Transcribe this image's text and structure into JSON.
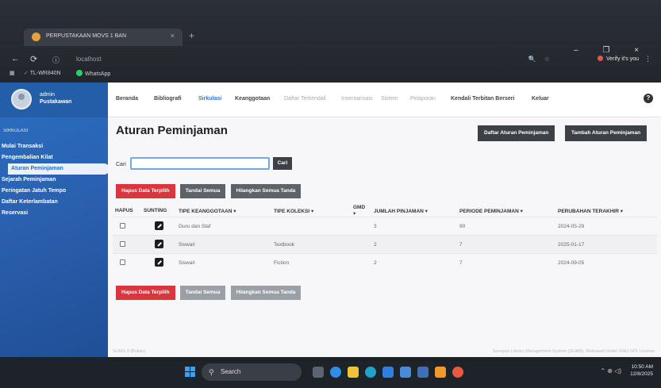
{
  "browser": {
    "tab_title": "PERPUSTAKAAN MOVS 1 BAN",
    "tab_close": "×",
    "new_tab": "+",
    "url": "localhost",
    "window_controls": "– ❐ ×",
    "verify_label": "Verify it's you",
    "bookmarks": [
      "TL-WR840N",
      "WhatsApp"
    ]
  },
  "sidebar": {
    "user_name": "admin",
    "user_role": "Pustakawan",
    "section": "SIRKULASI",
    "items": [
      {
        "label": "Mulai Transaksi"
      },
      {
        "label": "Pengembalian Kilat"
      },
      {
        "label": "Aturan Peminjaman",
        "active": true
      },
      {
        "label": "Sejarah Peminjaman"
      },
      {
        "label": "Peringatan Jatuh Tempo"
      },
      {
        "label": "Daftar Keterlambatan"
      },
      {
        "label": "Reservasi"
      }
    ]
  },
  "topnav": {
    "items": [
      "Beranda",
      "Bibliografi",
      "Sirkulasi",
      "Keanggotaan",
      "Daftar Terkendali",
      "Inventarisasi",
      "Sistem",
      "Pelaporan",
      "Kendali Terbitan Berseri",
      "Keluar"
    ],
    "help": "?"
  },
  "page": {
    "title": "Aturan Peminjaman",
    "btn_list": "Daftar Aturan Peminjaman",
    "btn_add": "Tambah Aturan Peminjaman",
    "search_label": "Cari",
    "search_value": "",
    "search_button": "Cari",
    "btn_delete": "Hapus Data Terpilih",
    "btn_mark_all": "Tandai Semua",
    "btn_unmark_all": "Hilangkan Semua Tanda"
  },
  "table": {
    "headers": [
      "HAPUS",
      "SUNTING",
      "TIPE KEANGGOTAAN ▾",
      "TIPE KOLEKSI ▾",
      "GMD ▾",
      "JUMLAH PINJAMAN ▾",
      "PERIODE PEMINJAMAN ▾",
      "PERUBAHAN TERAKHIR ▾"
    ],
    "rows": [
      [
        "Guru dan Staf",
        "",
        "",
        "3",
        "90",
        "2024-05-29"
      ],
      [
        "Siswa/i",
        "Textbook",
        "",
        "2",
        "7",
        "2025-01-17"
      ],
      [
        "Siswa/i",
        "Fiction",
        "",
        "2",
        "7",
        "2024-09-05"
      ]
    ]
  },
  "footer": {
    "left": "SLiMS 9 (Bulian)",
    "right": "Senayan Library Management System (SLiMS). Released Under GNU GPL License"
  },
  "taskbar": {
    "search_label": "Search",
    "time": "10:50 AM",
    "date": "12/8/2025"
  },
  "colors": {
    "sidebar": "#2a5fae",
    "accent_red": "#d9363e",
    "dark_button": "#3d4146",
    "nav_active": "#3574d1"
  }
}
